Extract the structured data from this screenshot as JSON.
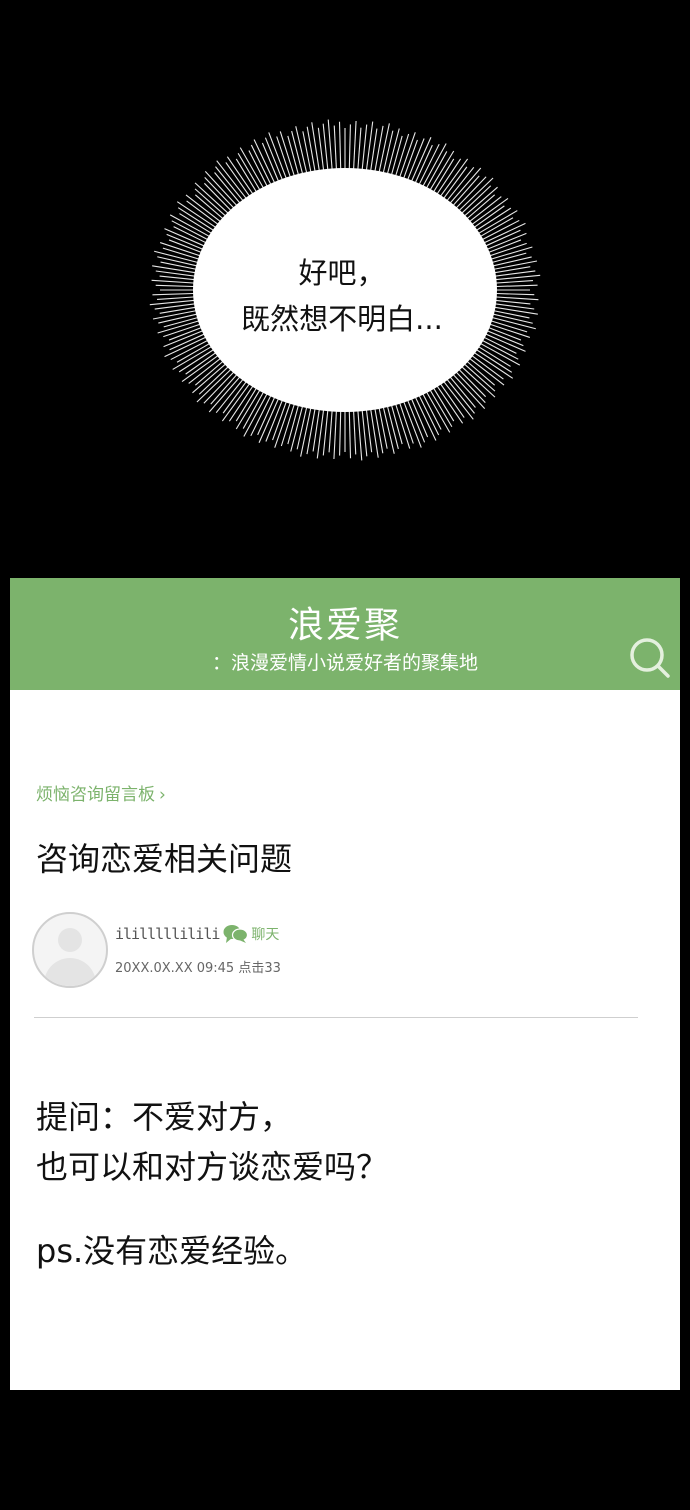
{
  "bubble": {
    "line1": "好吧，",
    "line2": "既然想不明白..."
  },
  "header": {
    "title": "浪爱聚",
    "subtitle": "：浪漫爱情小说爱好者的聚集地",
    "search_icon": "search-icon"
  },
  "post": {
    "breadcrumb": "烦恼咨询留言板",
    "title": "咨询恋爱相关问题",
    "author": {
      "username": "ililllllilili",
      "chat_label": "聊天",
      "meta": "20XX.0X.XX  09:45 点击33"
    },
    "body": {
      "question_line1": "提问：不爱对方，",
      "question_line2": "也可以和对方谈恋爱吗？",
      "ps": "ps.没有恋爱经验。"
    }
  },
  "colors": {
    "brand_green": "#7cb36c",
    "background": "#000000"
  }
}
